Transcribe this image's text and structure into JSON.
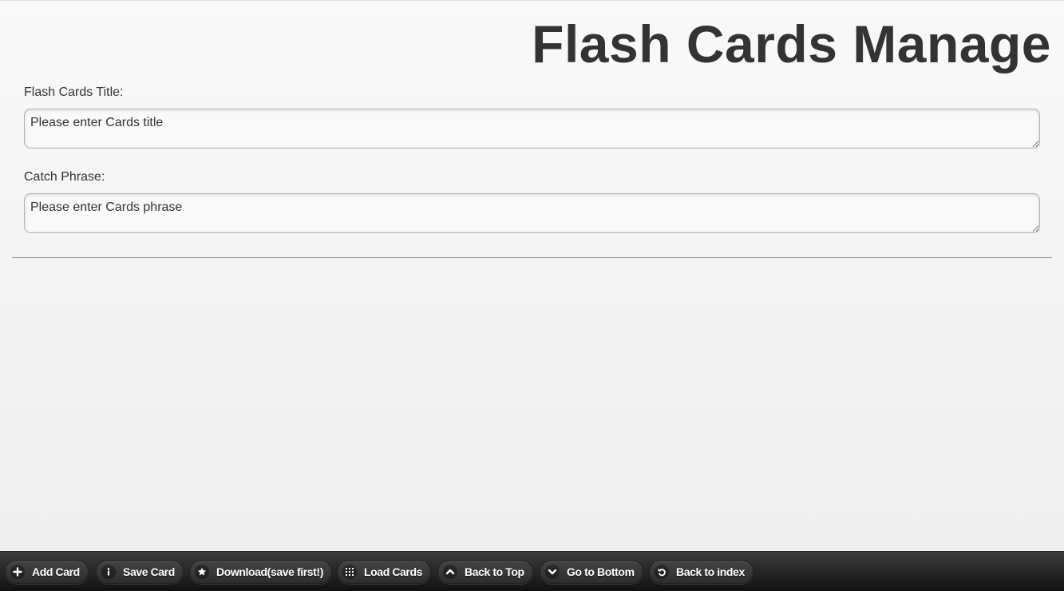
{
  "header": {
    "title": "Flash Cards Manage"
  },
  "form": {
    "title_field": {
      "label": "Flash Cards Title:",
      "placeholder": "Please enter Cards title",
      "value": ""
    },
    "phrase_field": {
      "label": "Catch Phrase:",
      "placeholder": "Please enter Cards phrase",
      "value": ""
    }
  },
  "footer": {
    "buttons": [
      {
        "label": "Add Card",
        "icon": "plus-icon"
      },
      {
        "label": "Save Card",
        "icon": "info-icon"
      },
      {
        "label": "Download(save first!)",
        "icon": "star-icon"
      },
      {
        "label": "Load Cards",
        "icon": "grid-icon"
      },
      {
        "label": "Back to Top",
        "icon": "chevron-up-icon"
      },
      {
        "label": "Go to Bottom",
        "icon": "chevron-down-icon"
      },
      {
        "label": "Back to index",
        "icon": "back-arrow-icon"
      }
    ]
  },
  "colors": {
    "text": "#333333",
    "footer_bg": "#1f1f1f",
    "button_text": "#ffffff"
  }
}
